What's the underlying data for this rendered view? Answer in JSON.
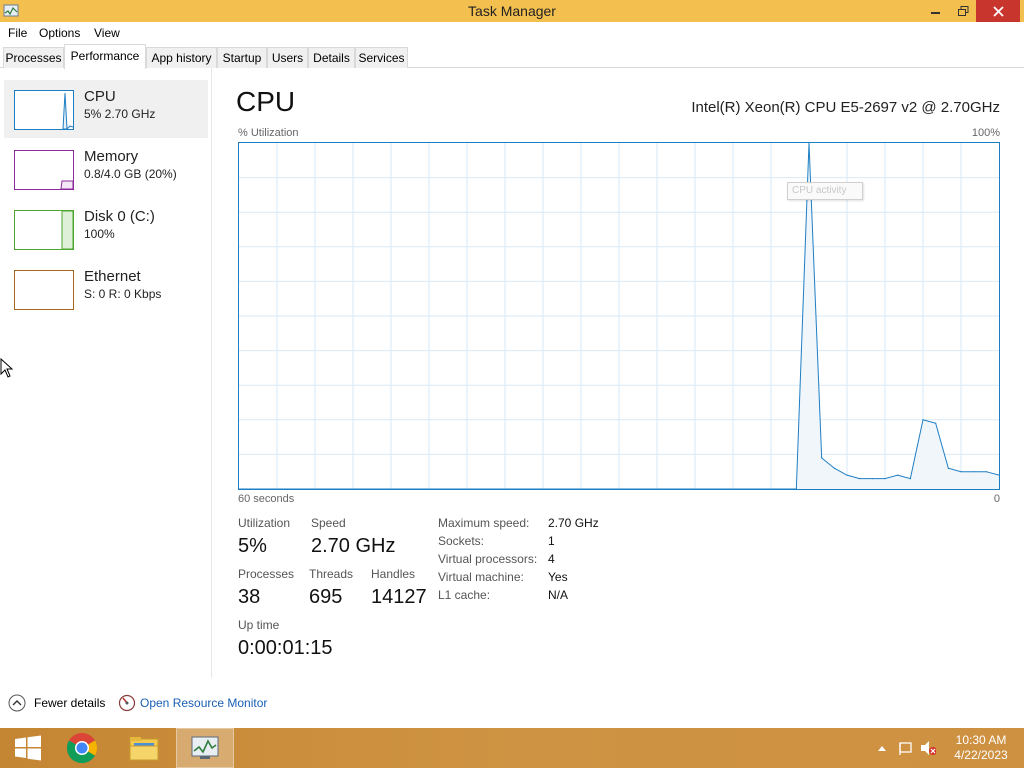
{
  "window": {
    "title": "Task Manager"
  },
  "menu": {
    "file": "File",
    "options": "Options",
    "view": "View"
  },
  "tabs": [
    {
      "label": "Processes",
      "active": false
    },
    {
      "label": "Performance",
      "active": true
    },
    {
      "label": "App history",
      "active": false
    },
    {
      "label": "Startup",
      "active": false
    },
    {
      "label": "Users",
      "active": false
    },
    {
      "label": "Details",
      "active": false
    },
    {
      "label": "Services",
      "active": false
    }
  ],
  "resources": [
    {
      "name": "CPU",
      "sub": "5% 2.70 GHz",
      "color": "#1e7ec4"
    },
    {
      "name": "Memory",
      "sub": "0.8/4.0 GB (20%)",
      "color": "#8b2a9b"
    },
    {
      "name": "Disk 0 (C:)",
      "sub": "100%",
      "color": "#4ea72e"
    },
    {
      "name": "Ethernet",
      "sub": "S: 0 R: 0 Kbps",
      "color": "#a7671f"
    }
  ],
  "main": {
    "title": "CPU",
    "model": "Intel(R) Xeon(R) CPU E5-2697 v2 @ 2.70GHz",
    "y_label": "% Utilization",
    "y_max_label": "100%",
    "x_left_label": "60 seconds",
    "x_right_label": "0",
    "tooltip": "CPU activity"
  },
  "chart_data": {
    "type": "area",
    "x": [
      60,
      16,
      15,
      14,
      13,
      12,
      11,
      10,
      9,
      8,
      7,
      6,
      5,
      4,
      3,
      2,
      1,
      0
    ],
    "values": [
      0,
      0,
      100,
      9,
      6,
      4,
      3,
      3,
      3,
      4,
      3,
      20,
      19,
      6,
      5,
      5,
      5,
      4
    ],
    "ylim": [
      0,
      100
    ],
    "xlim": [
      60,
      0
    ],
    "grid": true,
    "color": "#1e7ec4"
  },
  "stats": {
    "utilization_label": "Utilization",
    "utilization_value": "5%",
    "speed_label": "Speed",
    "speed_value": "2.70 GHz",
    "processes_label": "Processes",
    "processes_value": "38",
    "threads_label": "Threads",
    "threads_value": "695",
    "handles_label": "Handles",
    "handles_value": "14127",
    "uptime_label": "Up time",
    "uptime_value": "0:00:01:15"
  },
  "specs": [
    {
      "label": "Maximum speed:",
      "value": "2.70 GHz"
    },
    {
      "label": "Sockets:",
      "value": "1"
    },
    {
      "label": "Virtual processors:",
      "value": "4"
    },
    {
      "label": "Virtual machine:",
      "value": "Yes"
    },
    {
      "label": "L1 cache:",
      "value": "N/A"
    }
  ],
  "footer": {
    "fewer_details": "Fewer details",
    "resource_monitor": "Open Resource Monitor"
  },
  "taskbar": {
    "time": "10:30 AM",
    "date": "4/22/2023"
  }
}
